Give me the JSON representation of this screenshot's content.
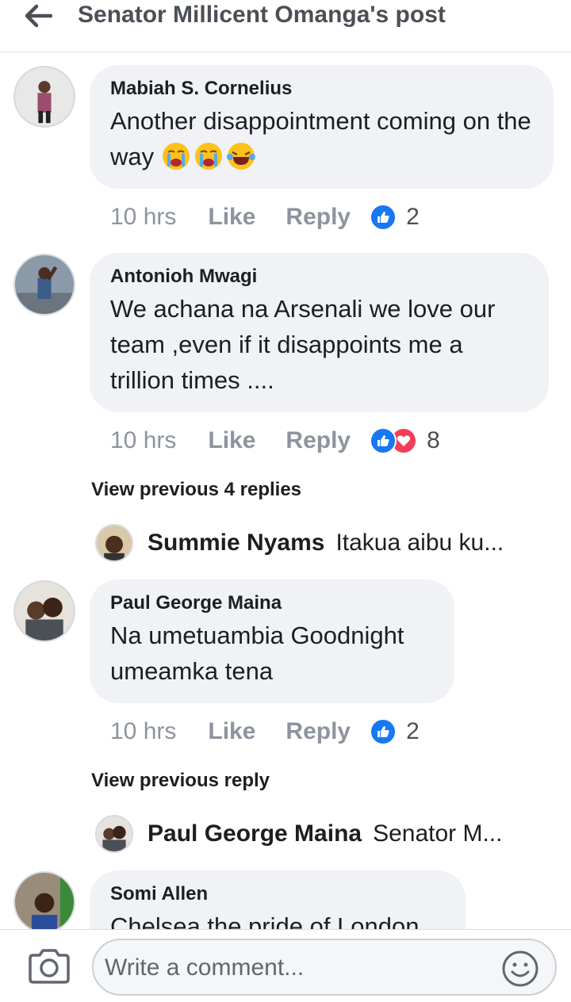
{
  "header": {
    "title": "Senator Millicent Omanga's post"
  },
  "comments": [
    {
      "author": "Mabiah S. Cornelius",
      "text": "Another disappointment coming on the way",
      "time": "10 hrs",
      "like": "Like",
      "reply": "Reply",
      "reaction_count": "2"
    },
    {
      "author": "Antonioh Mwagi",
      "text": "We achana na Arsenali we love our team ,even if it disappoints me a trillion times ....",
      "time": "10 hrs",
      "like": "Like",
      "reply": "Reply",
      "reaction_count": "8",
      "view_previous": "View previous 4 replies",
      "reply_preview": {
        "author": "Summie Nyams",
        "text": "Itakua aibu ku..."
      }
    },
    {
      "author": "Paul George Maina",
      "text_line1": "Na umetuambia Goodnight",
      "text_line2": "umeamka tena",
      "time": "10 hrs",
      "like": "Like",
      "reply": "Reply",
      "reaction_count": "2",
      "view_previous": "View previous reply",
      "reply_preview": {
        "author": "Paul George Maina",
        "text": "Senator M..."
      }
    },
    {
      "author": "Somi Allen",
      "text": "Chelsea the pride of London"
    }
  ],
  "composer": {
    "placeholder": "Write a comment..."
  },
  "icons": {
    "back": "back-arrow-icon",
    "camera": "camera-icon",
    "emoji": "smiley-icon",
    "like_reaction": "like-reaction-icon",
    "love_reaction": "love-reaction-icon"
  },
  "colors": {
    "like_blue": "#1877f2",
    "love_red": "#f33e58",
    "bubble": "#f0f2f5",
    "meta_gray": "#8d949e"
  }
}
